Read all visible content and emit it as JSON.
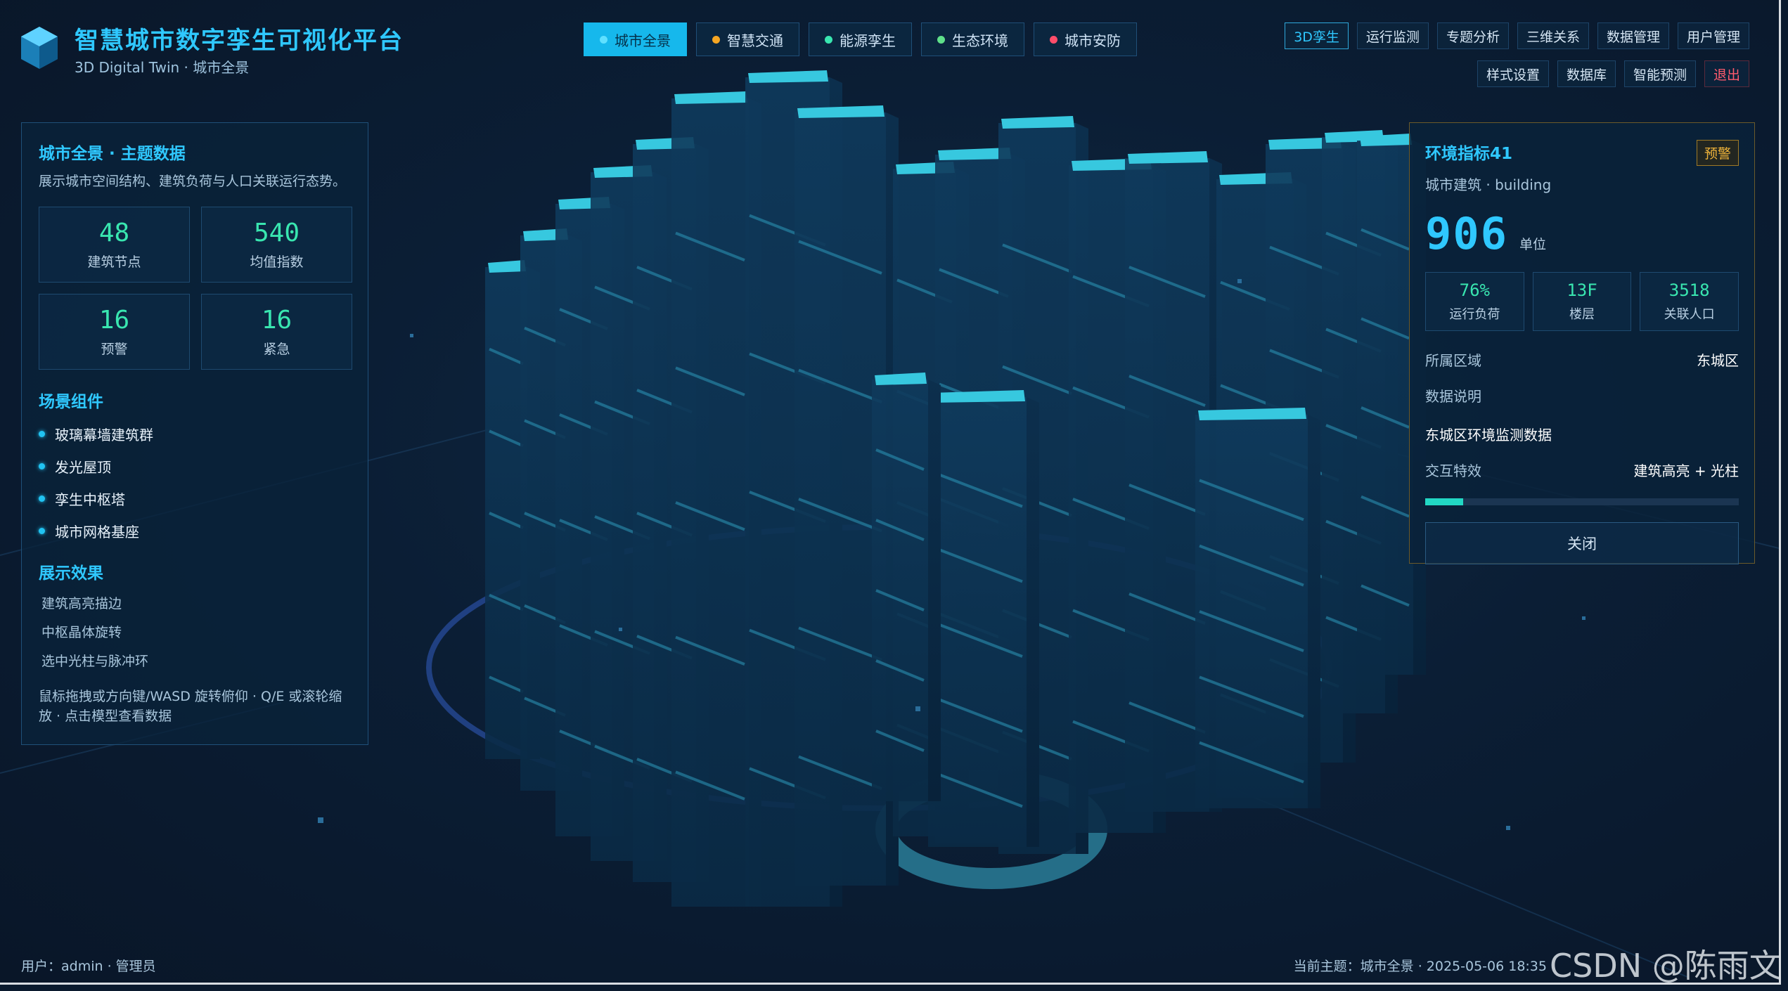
{
  "header": {
    "title": "智慧城市数字孪生可视化平台",
    "subtitle": "3D Digital Twin · 城市全景"
  },
  "tabs": [
    {
      "label": "城市全景",
      "color": "#5fe0ff",
      "active": true
    },
    {
      "label": "智慧交通",
      "color": "#f5a623",
      "active": false
    },
    {
      "label": "能源孪生",
      "color": "#39e6b0",
      "active": false
    },
    {
      "label": "生态环境",
      "color": "#5fe08a",
      "active": false
    },
    {
      "label": "城市安防",
      "color": "#ff4d6a",
      "active": false
    }
  ],
  "topnav": {
    "row1": [
      "3D孪生",
      "运行监测",
      "专题分析",
      "三维关系",
      "数据管理",
      "用户管理"
    ],
    "row2": [
      "样式设置",
      "数据库",
      "智能预测",
      "退出"
    ]
  },
  "left": {
    "title": "城市全景 · 主题数据",
    "desc": "展示城市空间结构、建筑负荷与人口关联运行态势。",
    "stats": [
      {
        "value": "48",
        "label": "建筑节点"
      },
      {
        "value": "540",
        "label": "均值指数"
      },
      {
        "value": "16",
        "label": "预警"
      },
      {
        "value": "16",
        "label": "紧急"
      }
    ],
    "components_title": "场景组件",
    "components": [
      "玻璃幕墙建筑群",
      "发光屋顶",
      "孪生中枢塔",
      "城市网格基座"
    ],
    "effects_title": "展示效果",
    "effects": [
      "建筑高亮描边",
      "中枢晶体旋转",
      "选中光柱与脉冲环"
    ],
    "tip": "鼠标拖拽或方向键/WASD 旋转俯仰 · Q/E 或滚轮缩放 · 点击模型查看数据"
  },
  "right": {
    "title": "环境指标41",
    "badge": "预警",
    "subtitle": "城市建筑 · building",
    "value": "906",
    "unit": "单位",
    "metrics": [
      {
        "value": "76%",
        "label": "运行负荷"
      },
      {
        "value": "13F",
        "label": "楼层"
      },
      {
        "value": "3518",
        "label": "关联人口"
      }
    ],
    "region_label": "所属区域",
    "region_value": "东城区",
    "desc_label": "数据说明",
    "desc_value": "东城区环境监测数据",
    "effect_label": "交互特效",
    "effect_value": "建筑高亮 + 光柱",
    "progress": 0.12,
    "close_label": "关闭"
  },
  "footer": {
    "user": "用户：admin · 管理员",
    "theme": "当前主题：城市全景 · 2025-05-06 18:35",
    "watermark": "CSDN @陈雨文"
  }
}
